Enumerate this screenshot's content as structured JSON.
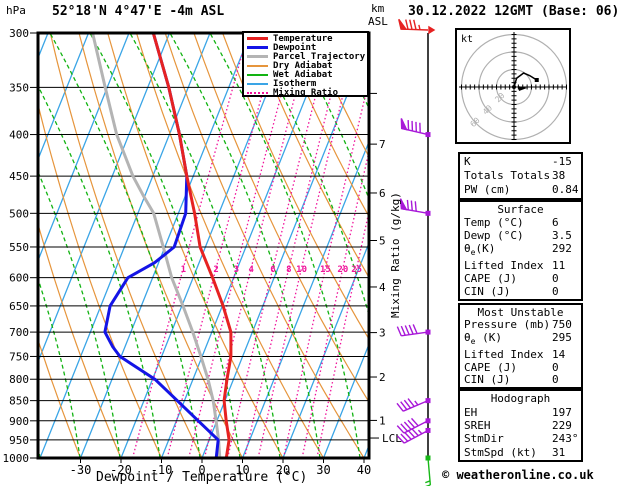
{
  "header": {
    "pressure_unit": "hPa",
    "station": "52°18'N 4°47'E -4m ASL",
    "datetime": "30.12.2022 12GMT (Base: 06)",
    "altitude_unit": "km",
    "altitude_ref": "ASL"
  },
  "legend": {
    "items": [
      {
        "label": "Temperature",
        "color": "#e62222",
        "thick": 3,
        "dash": ""
      },
      {
        "label": "Dewpoint",
        "color": "#1414e6",
        "thick": 3,
        "dash": ""
      },
      {
        "label": "Parcel Trajectory",
        "color": "#b4b4b4",
        "thick": 3,
        "dash": ""
      },
      {
        "label": "Dry Adiabat",
        "color": "#e6953c",
        "thick": 2,
        "dash": ""
      },
      {
        "label": "Wet Adiabat",
        "color": "#12b312",
        "thick": 2,
        "dash": ""
      },
      {
        "label": "Isotherm",
        "color": "#3aa5e6",
        "thick": 2,
        "dash": ""
      },
      {
        "label": "Mixing Ratio",
        "color": "#f0149b",
        "thick": 2,
        "dash": "2 3"
      }
    ]
  },
  "axes": {
    "pressure_ticks": [
      300,
      350,
      400,
      450,
      500,
      550,
      600,
      650,
      700,
      750,
      800,
      850,
      900,
      950,
      1000
    ],
    "temp_ticks": [
      -30,
      -20,
      -10,
      0,
      10,
      20,
      30,
      40
    ],
    "x_label": "Dewpoint / Temperature (°C)",
    "km_ticks": [
      7,
      6,
      5,
      4,
      3,
      2,
      1
    ],
    "lcl_label": "LCL",
    "mixing_axis_label": "Mixing Ratio (g/kg)",
    "mixing_ratio_labels": [
      1,
      2,
      3,
      4,
      6,
      8,
      10,
      15,
      20,
      25
    ]
  },
  "chart_data": {
    "type": "skewt-logp-sounding",
    "pressure_range_hpa": [
      300,
      1000
    ],
    "temp_axis_range_c": [
      -40,
      40
    ],
    "temperature_c": [
      [
        300,
        -54
      ],
      [
        350,
        -44.8
      ],
      [
        400,
        -37.5
      ],
      [
        450,
        -31.6
      ],
      [
        500,
        -26
      ],
      [
        550,
        -21.3
      ],
      [
        600,
        -15.2
      ],
      [
        650,
        -9.8
      ],
      [
        700,
        -5.3
      ],
      [
        750,
        -2.9
      ],
      [
        800,
        -1.6
      ],
      [
        850,
        -0.2
      ],
      [
        900,
        2.3
      ],
      [
        950,
        4.9
      ],
      [
        1000,
        6
      ]
    ],
    "dewpoint_c": [
      [
        300,
        -54
      ],
      [
        350,
        -44.8
      ],
      [
        400,
        -37.5
      ],
      [
        450,
        -31.6
      ],
      [
        500,
        -28.2
      ],
      [
        550,
        -27.7
      ],
      [
        575,
        -31
      ],
      [
        600,
        -36.1
      ],
      [
        650,
        -37.7
      ],
      [
        700,
        -36.4
      ],
      [
        730,
        -33
      ],
      [
        750,
        -30.3
      ],
      [
        800,
        -19.4
      ],
      [
        850,
        -11.8
      ],
      [
        900,
        -4.6
      ],
      [
        950,
        2.2
      ],
      [
        1000,
        3.5
      ]
    ],
    "parcel_c": [
      [
        300,
        -69
      ],
      [
        350,
        -60.5
      ],
      [
        400,
        -53
      ],
      [
        450,
        -44.9
      ],
      [
        475,
        -40.5
      ],
      [
        500,
        -36.1
      ],
      [
        550,
        -30.4
      ],
      [
        600,
        -25.3
      ],
      [
        650,
        -19.7
      ],
      [
        700,
        -14.7
      ],
      [
        750,
        -10.3
      ],
      [
        800,
        -6.3
      ],
      [
        850,
        -2.9
      ],
      [
        900,
        -0.2
      ],
      [
        950,
        2.3
      ],
      [
        1000,
        4.4
      ]
    ],
    "wind_barbs": [
      {
        "p": 300,
        "color": "#e62222",
        "flags": 1,
        "full": 3,
        "half": 1,
        "dir": 272
      },
      {
        "p": 400,
        "color": "#a818d8",
        "flags": 1,
        "full": 4,
        "half": 0,
        "dir": 283
      },
      {
        "p": 500,
        "color": "#a818d8",
        "flags": 1,
        "full": 3,
        "half": 0,
        "dir": 280
      },
      {
        "p": 700,
        "color": "#a818d8",
        "flags": 0,
        "full": 5,
        "half": 0,
        "dir": 262
      },
      {
        "p": 850,
        "color": "#a818d8",
        "flags": 0,
        "full": 4,
        "half": 1,
        "dir": 247
      },
      {
        "p": 900,
        "color": "#a818d8",
        "flags": 0,
        "full": 5,
        "half": 0,
        "dir": 243
      },
      {
        "p": 925,
        "color": "#a818d8",
        "flags": 0,
        "full": 5,
        "half": 1,
        "dir": 242
      },
      {
        "p": 1000,
        "color": "#18b818",
        "flags": 0,
        "full": 1,
        "half": 1,
        "dir": 175
      }
    ],
    "hodograph": {
      "unit": "kt",
      "rings_kt": [
        20,
        40,
        60
      ],
      "trace_uv_kt": [
        [
          0,
          0
        ],
        [
          3,
          10
        ],
        [
          11,
          16
        ],
        [
          18,
          13
        ],
        [
          26,
          8
        ]
      ],
      "storm_motion": {
        "dir_deg": 243,
        "speed_kt": 31
      }
    }
  },
  "hodograph_panel": {
    "unit_label": "kt",
    "ring_labels": [
      "20",
      "40",
      "60"
    ]
  },
  "panels": [
    {
      "title": "",
      "rows": [
        [
          "K",
          "-15"
        ],
        [
          "Totals Totals",
          "38"
        ],
        [
          "PW (cm)",
          "0.84"
        ]
      ]
    },
    {
      "title": "Surface",
      "rows": [
        [
          "Temp (°C)",
          "6"
        ],
        [
          "Dewp (°C)",
          "3.5"
        ],
        [
          "θe(K)",
          "292"
        ],
        [
          "Lifted Index",
          "11"
        ],
        [
          "CAPE (J)",
          "0"
        ],
        [
          "CIN (J)",
          "0"
        ]
      ]
    },
    {
      "title": "Most Unstable",
      "rows": [
        [
          "Pressure (mb)",
          "750"
        ],
        [
          "θe (K)",
          "295"
        ],
        [
          "Lifted Index",
          "14"
        ],
        [
          "CAPE (J)",
          "0"
        ],
        [
          "CIN (J)",
          "0"
        ]
      ]
    },
    {
      "title": "Hodograph",
      "rows": [
        [
          "EH",
          "197"
        ],
        [
          "SREH",
          "229"
        ],
        [
          "StmDir",
          "243°"
        ],
        [
          "StmSpd (kt)",
          "31"
        ]
      ]
    }
  ],
  "watermark": "© weatheronline.co.uk",
  "colors": {
    "temperature": "#e62222",
    "dewpoint": "#1414e6",
    "parcel": "#b4b4b4",
    "dry_adiabat": "#e6953c",
    "wet_adiabat": "#12b312",
    "isotherm": "#3aa5e6",
    "mixing_ratio": "#f0149b",
    "barb_upper": "#a818d8",
    "barb_surface": "#18b818",
    "ring_gray": "#b0b0b0"
  }
}
